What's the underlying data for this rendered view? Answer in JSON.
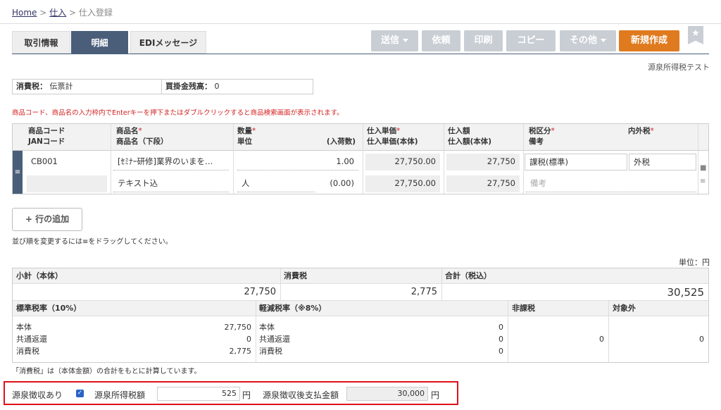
{
  "breadcrumb": {
    "home": "Home",
    "sep": ">",
    "purchase": "仕入",
    "current": "仕入登録"
  },
  "tabs": [
    {
      "label": "取引情報",
      "active": false
    },
    {
      "label": "明細",
      "active": true
    },
    {
      "label": "EDIメッセージ",
      "active": false
    }
  ],
  "toolbar": {
    "send": "送信",
    "request": "依頼",
    "print": "印刷",
    "copy": "コピー",
    "other": "その他",
    "new": "新規作成"
  },
  "page_subtitle": "源泉所得税テスト",
  "info": {
    "tax_label": "消費税：",
    "tax_value": "伝票計",
    "balance_label": "買掛金残高：",
    "balance_value": "0"
  },
  "notice": "商品コード、商品名の入力枠内でEnterキーを押下またはダブルクリックすると商品検索画面が表示されます。",
  "grid": {
    "headers": {
      "code1": "商品コード",
      "code2": "JANコード",
      "name1": "商品名",
      "name2": "商品名（下段）",
      "qty1": "数量",
      "qty2": "単位",
      "qty3": "(入荷数)",
      "price1": "仕入単価",
      "price2": "仕入単価(本体)",
      "amt1": "仕入額",
      "amt2": "仕入額(本体)",
      "tax1": "税区分",
      "tax2": "備考",
      "intax": "内外税",
      "req": "*"
    },
    "row": {
      "code": "CB001",
      "jan": "",
      "name": "[ｾﾐﾅｰ研修]業界のいまを…",
      "name2": "テキスト込",
      "qty": "1.00",
      "unit": "人",
      "received": "(0.00)",
      "price": "27,750.00",
      "price_body": "27,750.00",
      "amount": "27,750",
      "amount_body": "27,750",
      "tax_type": "課税(標準)",
      "in_out_tax": "外税",
      "memo_placeholder": "備考"
    },
    "handle_icon": "drag-handle-icon"
  },
  "add_row": "+ 行の追加",
  "sort_hint": "並び順を変更するには≡をドラッグしてください。",
  "unit_label": "単位：円",
  "summary": {
    "subtotal_label": "小計（本体）",
    "subtotal": "27,750",
    "tax_label": "消費税",
    "tax": "2,775",
    "total_label": "合計（税込）",
    "total": "30,525",
    "standard_label": "標準税率（10%）",
    "reduced_label": "軽減税率（※8%）",
    "nontax_label": "非課税",
    "exempt_label": "対象外",
    "row_labels": [
      "本体",
      "共通返還",
      "消費税"
    ],
    "standard_values": [
      "27,750",
      "0",
      "2,775"
    ],
    "reduced_values": [
      "0",
      "0",
      "0"
    ],
    "nontax_value": "0",
    "exempt_value": "0"
  },
  "calc_note": "「消費税」は（本体金額）の合計をもとに計算しています。",
  "withholding": {
    "enabled_label": "源泉徴収あり",
    "checked": true,
    "tax_label": "源泉所得税額",
    "tax_value": "525",
    "yen": "円",
    "after_label": "源泉徴収後支払金額",
    "after_value": "30,000"
  }
}
